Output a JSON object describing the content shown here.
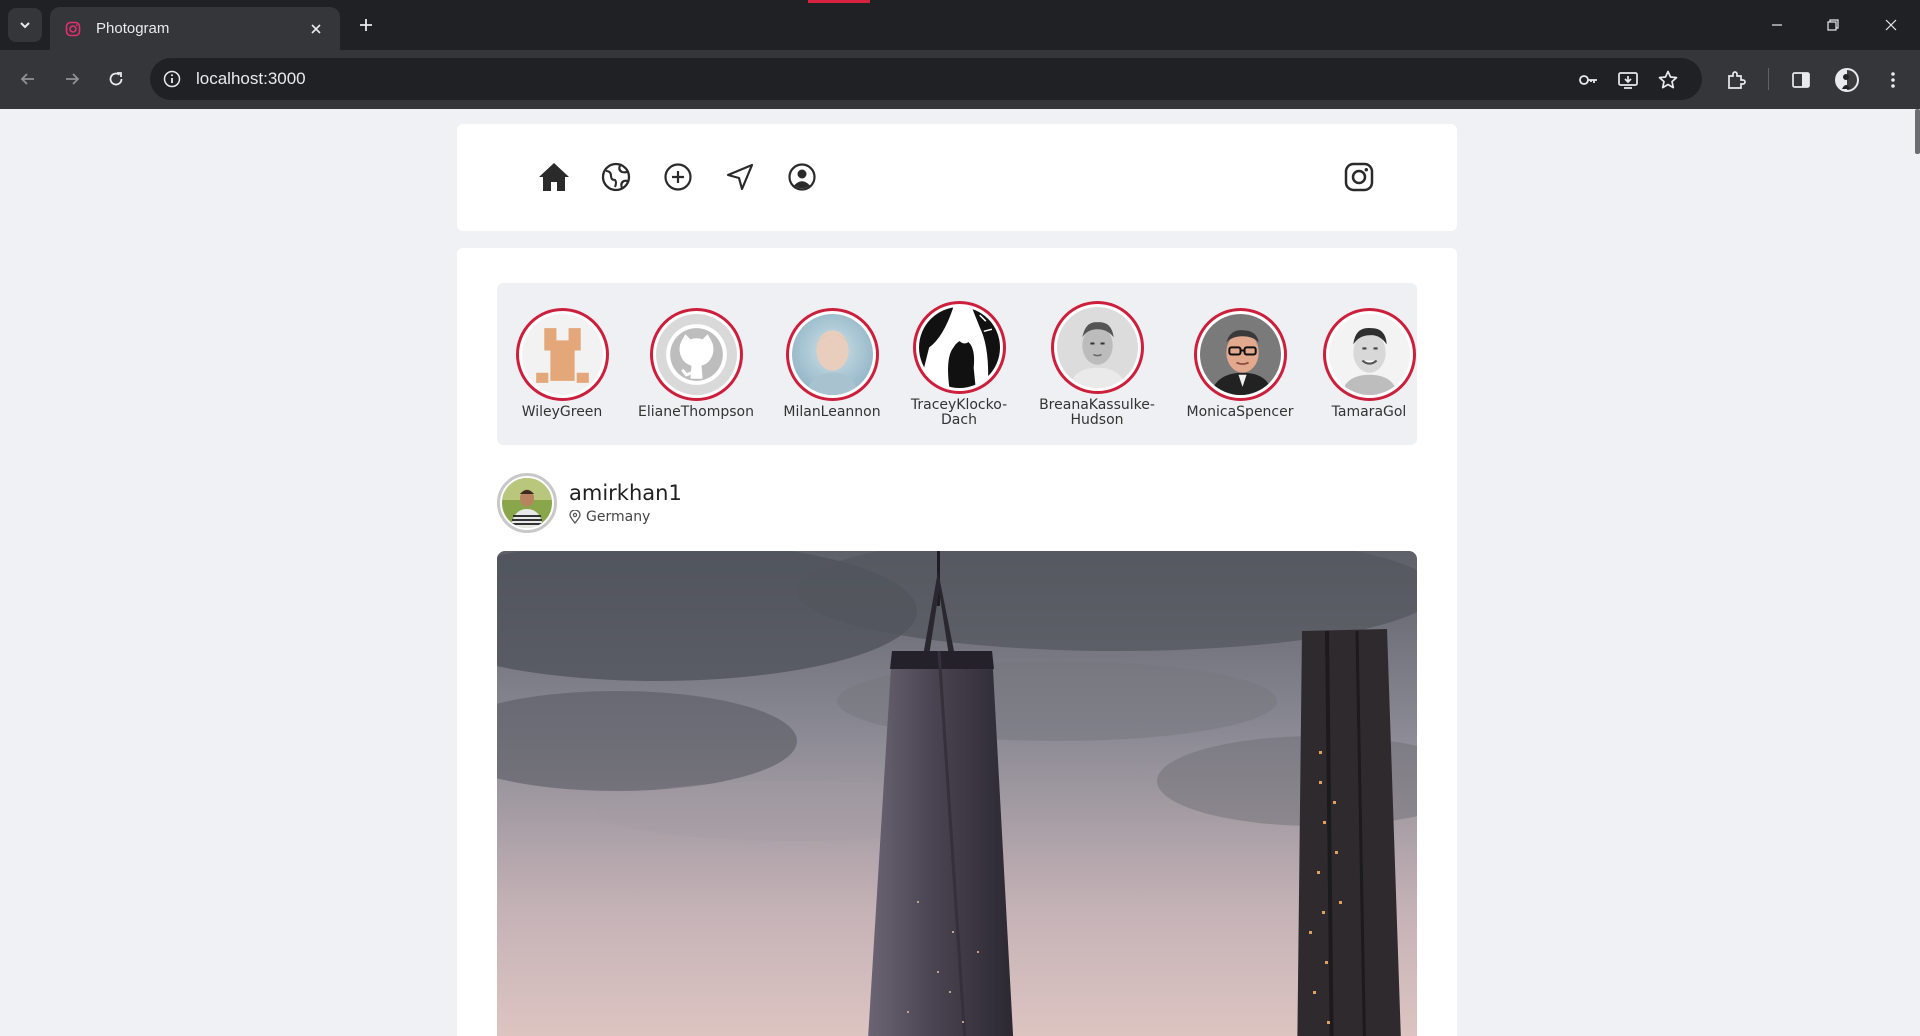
{
  "browser": {
    "tab_title": "Photogram",
    "url": "localhost:3000",
    "colors": {
      "frame": "#202124",
      "toolbar": "#35363a",
      "accent": "#d6213f"
    }
  },
  "navbar": {
    "icons": [
      "home-icon",
      "globe-icon",
      "add-circle-icon",
      "send-icon",
      "user-circle-icon",
      "instagram-icon"
    ]
  },
  "stories": [
    {
      "name": "WileyGreen",
      "avatar": "identicon-orange"
    },
    {
      "name": "ElianeThompson",
      "avatar": "github-octocat"
    },
    {
      "name": "MilanLeannon",
      "avatar": "portrait-blue"
    },
    {
      "name": "TraceyKlocko-Dach",
      "avatar": "portrait-bw"
    },
    {
      "name": "BreanaKassulke-Hudson",
      "avatar": "portrait-grey"
    },
    {
      "name": "MonicaSpencer",
      "avatar": "portrait-glasses"
    },
    {
      "name": "TamaraGol",
      "avatar": "portrait-smile"
    }
  ],
  "post": {
    "username": "amirkhan1",
    "location": "Germany",
    "image": "city-skyscrapers-at-dusk"
  },
  "colors": {
    "story_ring": "#cc1f3c",
    "page_bg": "#f0f1f4",
    "card_bg": "#ffffff"
  }
}
